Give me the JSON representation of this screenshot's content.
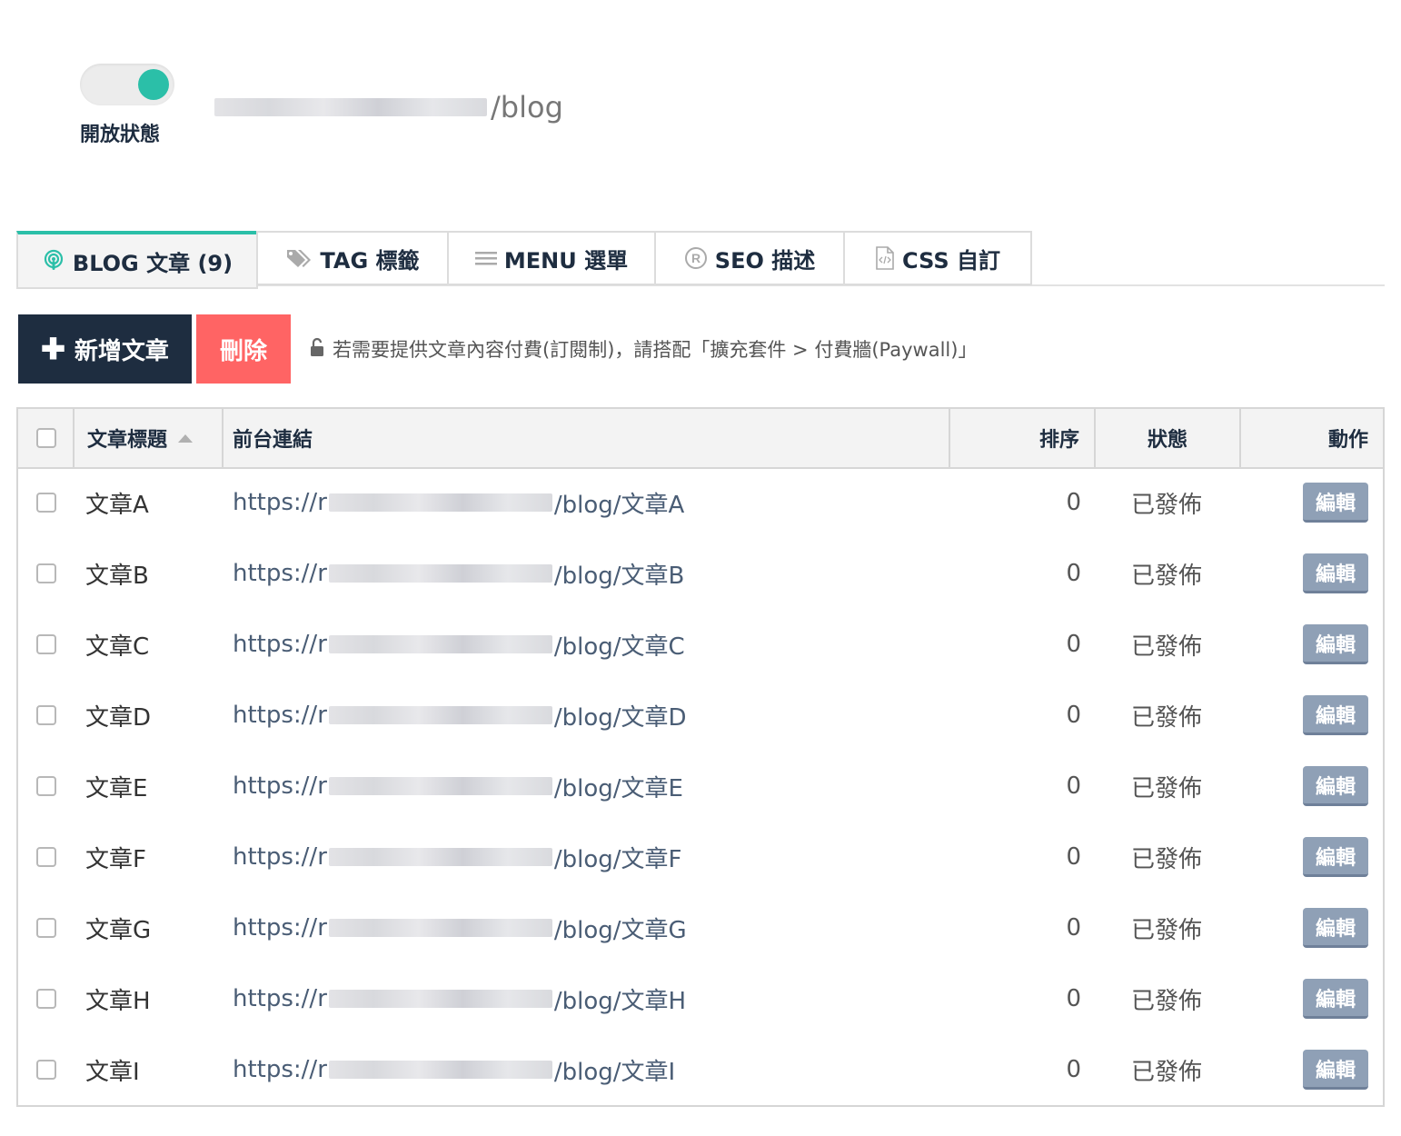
{
  "header": {
    "toggle_label": "開放狀態",
    "url_suffix": "/blog",
    "toggle_color": "#2bbfa8"
  },
  "tabs": [
    {
      "icon": "podcast-icon",
      "label": "BLOG 文章 (9)",
      "active": true
    },
    {
      "icon": "tags-icon",
      "label": "TAG 標籤",
      "active": false
    },
    {
      "icon": "menu-icon",
      "label": "MENU 選單",
      "active": false
    },
    {
      "icon": "registered-icon",
      "label": "SEO 描述",
      "active": false
    },
    {
      "icon": "code-file-icon",
      "label": "CSS 自訂",
      "active": false
    }
  ],
  "toolbar": {
    "add_label": "新增文章",
    "delete_label": "刪除",
    "note": "若需要提供文章內容付費(訂閱制)，請搭配「擴充套件 > 付費牆(Paywall)」"
  },
  "table": {
    "headers": {
      "title": "文章標題",
      "link": "前台連結",
      "order": "排序",
      "status": "狀態",
      "action": "動作"
    },
    "link_prefix": "https://r",
    "rows": [
      {
        "title": "文章A",
        "link_suffix": "/blog/文章A",
        "order": "0",
        "status": "已發佈",
        "action": "編輯"
      },
      {
        "title": "文章B",
        "link_suffix": "/blog/文章B",
        "order": "0",
        "status": "已發佈",
        "action": "編輯"
      },
      {
        "title": "文章C",
        "link_suffix": "/blog/文章C",
        "order": "0",
        "status": "已發佈",
        "action": "編輯"
      },
      {
        "title": "文章D",
        "link_suffix": "/blog/文章D",
        "order": "0",
        "status": "已發佈",
        "action": "編輯"
      },
      {
        "title": "文章E",
        "link_suffix": "/blog/文章E",
        "order": "0",
        "status": "已發佈",
        "action": "編輯"
      },
      {
        "title": "文章F",
        "link_suffix": "/blog/文章F",
        "order": "0",
        "status": "已發佈",
        "action": "編輯"
      },
      {
        "title": "文章G",
        "link_suffix": "/blog/文章G",
        "order": "0",
        "status": "已發佈",
        "action": "編輯"
      },
      {
        "title": "文章H",
        "link_suffix": "/blog/文章H",
        "order": "0",
        "status": "已發佈",
        "action": "編輯"
      },
      {
        "title": "文章I",
        "link_suffix": "/blog/文章I",
        "order": "0",
        "status": "已發佈",
        "action": "編輯"
      }
    ]
  }
}
